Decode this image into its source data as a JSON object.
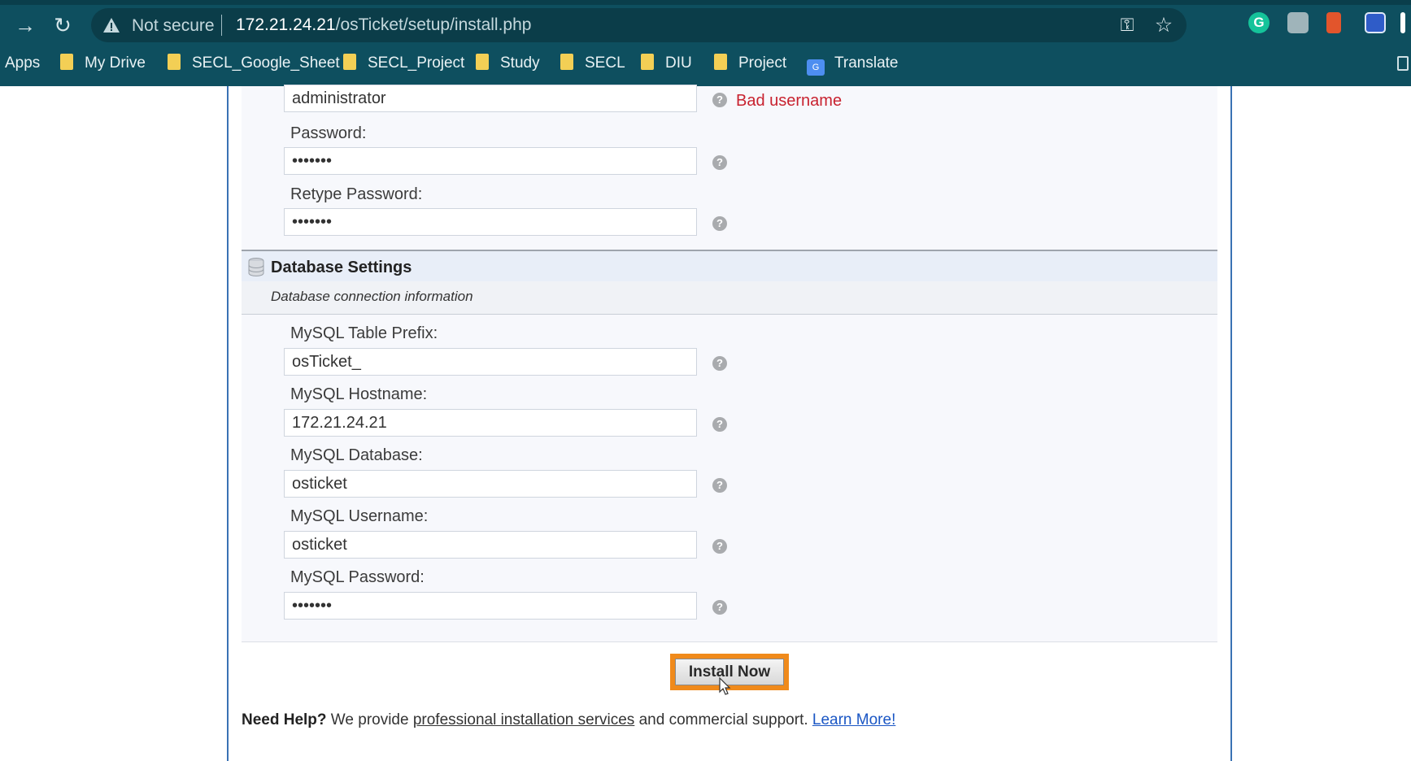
{
  "browser": {
    "address_warning": "Not secure",
    "url_host": "172.21.24.21",
    "url_path": "/osTicket/setup/install.php",
    "bookmarks": [
      {
        "label": "Apps",
        "type": "apps"
      },
      {
        "label": "My Drive",
        "type": "folder"
      },
      {
        "label": "SECL_Google_Sheet",
        "type": "folder"
      },
      {
        "label": "SECL_Project",
        "type": "folder"
      },
      {
        "label": "Study",
        "type": "folder"
      },
      {
        "label": "SECL",
        "type": "folder"
      },
      {
        "label": "DIU",
        "type": "folder"
      },
      {
        "label": "Project",
        "type": "folder"
      },
      {
        "label": "Translate",
        "type": "translate"
      }
    ]
  },
  "admin": {
    "username_value": "administrator",
    "username_error": "Bad username",
    "password_label": "Password:",
    "password_value": "•••••••",
    "retype_label": "Retype Password:",
    "retype_value": "•••••••"
  },
  "database": {
    "title": "Database Settings",
    "subtitle": "Database connection information",
    "prefix_label": "MySQL Table Prefix:",
    "prefix_value": "osTicket_",
    "hostname_label": "MySQL Hostname:",
    "hostname_value": "172.21.24.21",
    "database_label": "MySQL Database:",
    "database_value": "osticket",
    "username_label": "MySQL Username:",
    "username_value": "osticket",
    "password_label": "MySQL Password:",
    "password_value": "•••••••"
  },
  "install_button": "Install Now",
  "help": {
    "lead": "Need Help?",
    "text1": " We provide ",
    "link1": "professional installation services",
    "text2": " and commercial support. ",
    "link2": "Learn More!"
  },
  "colors": {
    "chrome_bg": "#0e4f5f",
    "error": "#c8222f",
    "highlight": "#f08a1b",
    "link": "#1a56c4"
  }
}
